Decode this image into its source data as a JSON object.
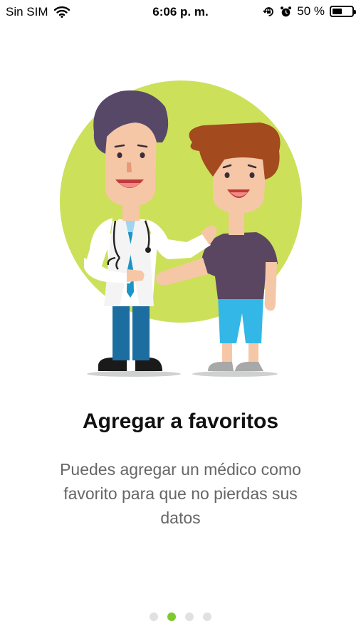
{
  "status_bar": {
    "carrier": "Sin SIM",
    "time": "6:06 p. m.",
    "battery_percent": "50 %",
    "battery_level": 0.5,
    "icons": [
      "wifi-icon",
      "orientation-lock-icon",
      "alarm-icon",
      "battery-icon"
    ]
  },
  "onboarding": {
    "title": "Agregar a favoritos",
    "description": "Puedes agregar un médico como favorito para que no pierdas sus datos",
    "illustration": "doctor-patient-illustration",
    "pages": 4,
    "current_page": 2
  },
  "colors": {
    "accent": "#7fc82f",
    "circle": "#cce05a",
    "inactive_dot": "#e1e1e1"
  }
}
